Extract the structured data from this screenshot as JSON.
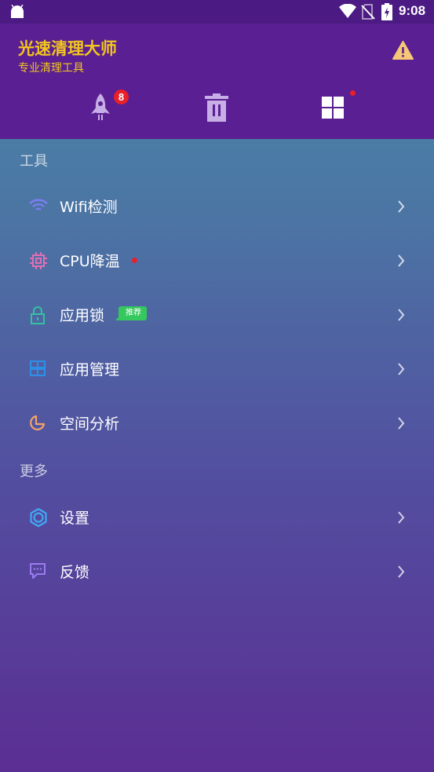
{
  "status_bar": {
    "time": "9:08"
  },
  "header": {
    "title": "光速清理大师",
    "subtitle": "专业清理工具",
    "rocket_badge": "8"
  },
  "sections": {
    "tools_title": "工具",
    "more_title": "更多"
  },
  "tools": [
    {
      "label": "Wifi检测",
      "icon": "wifi-icon",
      "color": "#7f7cf0"
    },
    {
      "label": "CPU降温",
      "icon": "chip-icon",
      "color": "#e06fb5",
      "dot": true
    },
    {
      "label": "应用锁",
      "icon": "lock-icon",
      "color": "#33c2a0",
      "tag": "推荐"
    },
    {
      "label": "应用管理",
      "icon": "apps-manage-icon",
      "color": "#2f8fe6"
    },
    {
      "label": "空间分析",
      "icon": "pie-chart-icon",
      "color": "#f3a36b"
    }
  ],
  "more": [
    {
      "label": "设置",
      "icon": "gear-icon",
      "color": "#42a9f2"
    },
    {
      "label": "反馈",
      "icon": "feedback-icon",
      "color": "#9b7cf0"
    }
  ],
  "colors": {
    "header_bg": "#5a1f92",
    "title": "#f2c61f",
    "badge": "#e8202a",
    "tag": "#34c85e"
  }
}
